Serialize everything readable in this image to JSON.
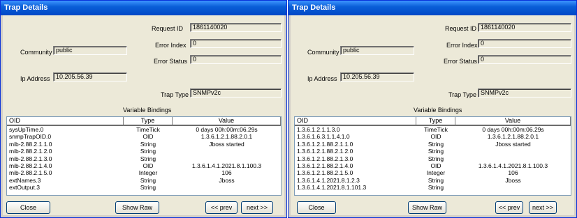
{
  "left": {
    "title": "Trap Details",
    "request_id_label": "Request ID",
    "request_id": "1861140020",
    "error_index_label": "Error Index",
    "error_index": "0",
    "error_status_label": "Error Status",
    "error_status": "0",
    "community_label": "Community",
    "community": "public",
    "ip_label": "Ip Address",
    "ip": "10.205.56.39",
    "trap_type_label": "Trap Type",
    "trap_type": "SNMPv2c",
    "bindings_label": "Variable Bindings",
    "columns": [
      "OID",
      "Type",
      "Value"
    ],
    "rows": [
      {
        "oid": "sysUpTime.0",
        "type": "TimeTick",
        "value": "0 days 00h:00m:06.29s"
      },
      {
        "oid": "snmpTrapOID.0",
        "type": "OID",
        "value": "1.3.6.1.2.1.88.2.0.1"
      },
      {
        "oid": "mib-2.88.2.1.1.0",
        "type": "String",
        "value": "Jboss started"
      },
      {
        "oid": "mib-2.88.2.1.2.0",
        "type": "String",
        "value": ""
      },
      {
        "oid": "mib-2.88.2.1.3.0",
        "type": "String",
        "value": ""
      },
      {
        "oid": "mib-2.88.2.1.4.0",
        "type": "OID",
        "value": "1.3.6.1.4.1.2021.8.1.100.3"
      },
      {
        "oid": "mib-2.88.2.1.5.0",
        "type": "Integer",
        "value": "106"
      },
      {
        "oid": "extNames.3",
        "type": "String",
        "value": "Jboss"
      },
      {
        "oid": "extOutput.3",
        "type": "String",
        "value": ""
      }
    ],
    "close_label": "Close",
    "show_raw_label": "Show Raw",
    "prev_label": "<< prev",
    "next_label": "next >>"
  },
  "right": {
    "title": "Trap Details",
    "request_id_label": "Request ID",
    "request_id": "1861140020",
    "error_index_label": "Error Index",
    "error_index": "0",
    "error_status_label": "Error Status",
    "error_status": "0",
    "community_label": "Community",
    "community": "public",
    "ip_label": "Ip Address",
    "ip": "10.205.56.39",
    "trap_type_label": "Trap Type",
    "trap_type": "SNMPv2c",
    "bindings_label": "Variable Bindings",
    "columns": [
      "OID",
      "Type",
      "Value"
    ],
    "rows": [
      {
        "oid": "1.3.6.1.2.1.1.3.0",
        "type": "TimeTick",
        "value": "0 days 00h:00m:06.29s"
      },
      {
        "oid": "1.3.6.1.6.3.1.1.4.1.0",
        "type": "OID",
        "value": "1.3.6.1.2.1.88.2.0.1"
      },
      {
        "oid": "1.3.6.1.2.1.88.2.1.1.0",
        "type": "String",
        "value": "Jboss started"
      },
      {
        "oid": "1.3.6.1.2.1.88.2.1.2.0",
        "type": "String",
        "value": ""
      },
      {
        "oid": "1.3.6.1.2.1.88.2.1.3.0",
        "type": "String",
        "value": ""
      },
      {
        "oid": "1.3.6.1.2.1.88.2.1.4.0",
        "type": "OID",
        "value": "1.3.6.1.4.1.2021.8.1.100.3"
      },
      {
        "oid": "1.3.6.1.2.1.88.2.1.5.0",
        "type": "Integer",
        "value": "106"
      },
      {
        "oid": "1.3.6.1.4.1.2021.8.1.2.3",
        "type": "String",
        "value": "Jboss"
      },
      {
        "oid": "1.3.6.1.4.1.2021.8.1.101.3",
        "type": "String",
        "value": ""
      }
    ],
    "close_label": "Close",
    "show_raw_label": "Show Raw",
    "prev_label": "<< prev",
    "next_label": "next >>"
  }
}
